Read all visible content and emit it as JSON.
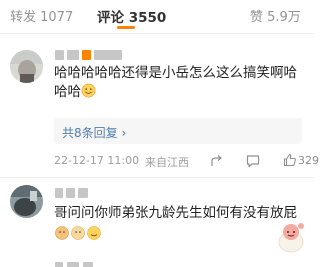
{
  "tabs": {
    "repost": "转发 1077",
    "comments": "评论 3550",
    "likes": "赞 5.9万"
  },
  "comment1": {
    "text_line1": "哈哈哈哈哈还得是小岳怎么这么搞笑啊哈",
    "text_line2": "哈哈",
    "emoji": "smile-emoji",
    "replies_link": "共8条回复 ›",
    "date_time": "22-12-17 11:00",
    "location": "来自江西",
    "like_count": "329"
  },
  "comment2": {
    "text": "哥问问你师弟张九龄先生如何有没有放屁"
  },
  "colors": {
    "accent": "#ff8200",
    "link": "#507daf",
    "muted": "#9e9e9e"
  }
}
